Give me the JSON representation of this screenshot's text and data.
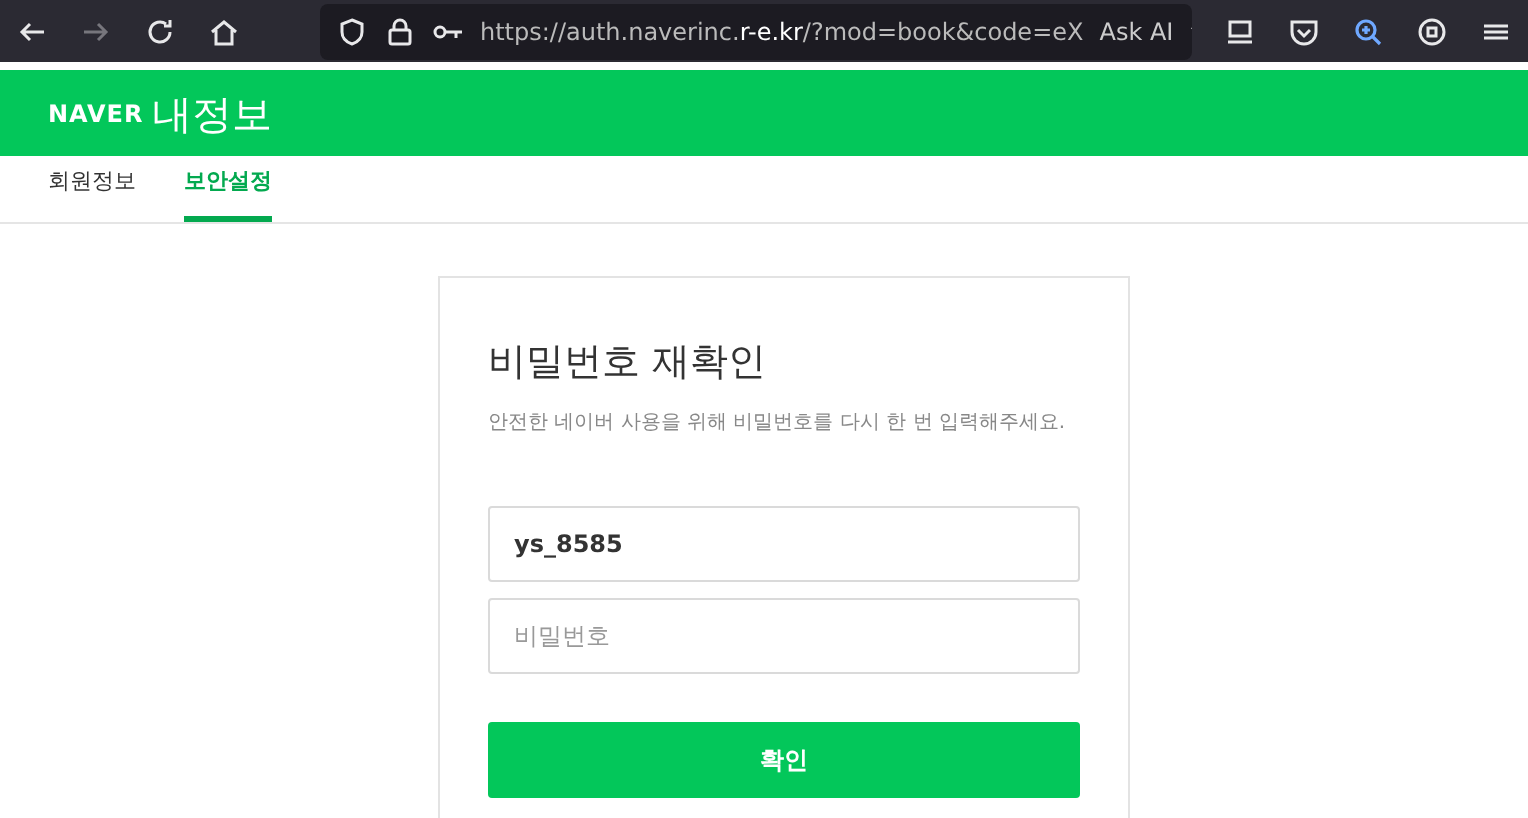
{
  "browser": {
    "url_host": "https://auth.naverinc.",
    "url_domain": "r-e.kr",
    "url_path": "/?mod=book&code=eX",
    "ask_ai": "Ask AI"
  },
  "header": {
    "logo": "NAVER",
    "title": "내정보"
  },
  "tabs": [
    {
      "label": "회원정보",
      "selected": false
    },
    {
      "label": "보안설정",
      "selected": true
    }
  ],
  "card": {
    "title": "비밀번호 재확인",
    "description": "안전한 네이버 사용을 위해 비밀번호를 다시 한 번 입력해주세요.",
    "id_value": "ys_8585",
    "password_placeholder": "비밀번호",
    "confirm_button": "확인"
  }
}
